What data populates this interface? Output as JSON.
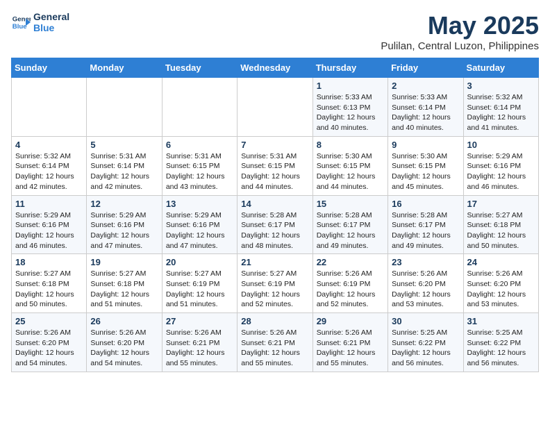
{
  "logo": {
    "line1": "General",
    "line2": "Blue"
  },
  "title": "May 2025",
  "location": "Pulilan, Central Luzon, Philippines",
  "days_of_week": [
    "Sunday",
    "Monday",
    "Tuesday",
    "Wednesday",
    "Thursday",
    "Friday",
    "Saturday"
  ],
  "weeks": [
    [
      {
        "day": "",
        "info": ""
      },
      {
        "day": "",
        "info": ""
      },
      {
        "day": "",
        "info": ""
      },
      {
        "day": "",
        "info": ""
      },
      {
        "day": "1",
        "info": "Sunrise: 5:33 AM\nSunset: 6:13 PM\nDaylight: 12 hours\nand 40 minutes."
      },
      {
        "day": "2",
        "info": "Sunrise: 5:33 AM\nSunset: 6:14 PM\nDaylight: 12 hours\nand 40 minutes."
      },
      {
        "day": "3",
        "info": "Sunrise: 5:32 AM\nSunset: 6:14 PM\nDaylight: 12 hours\nand 41 minutes."
      }
    ],
    [
      {
        "day": "4",
        "info": "Sunrise: 5:32 AM\nSunset: 6:14 PM\nDaylight: 12 hours\nand 42 minutes."
      },
      {
        "day": "5",
        "info": "Sunrise: 5:31 AM\nSunset: 6:14 PM\nDaylight: 12 hours\nand 42 minutes."
      },
      {
        "day": "6",
        "info": "Sunrise: 5:31 AM\nSunset: 6:15 PM\nDaylight: 12 hours\nand 43 minutes."
      },
      {
        "day": "7",
        "info": "Sunrise: 5:31 AM\nSunset: 6:15 PM\nDaylight: 12 hours\nand 44 minutes."
      },
      {
        "day": "8",
        "info": "Sunrise: 5:30 AM\nSunset: 6:15 PM\nDaylight: 12 hours\nand 44 minutes."
      },
      {
        "day": "9",
        "info": "Sunrise: 5:30 AM\nSunset: 6:15 PM\nDaylight: 12 hours\nand 45 minutes."
      },
      {
        "day": "10",
        "info": "Sunrise: 5:29 AM\nSunset: 6:16 PM\nDaylight: 12 hours\nand 46 minutes."
      }
    ],
    [
      {
        "day": "11",
        "info": "Sunrise: 5:29 AM\nSunset: 6:16 PM\nDaylight: 12 hours\nand 46 minutes."
      },
      {
        "day": "12",
        "info": "Sunrise: 5:29 AM\nSunset: 6:16 PM\nDaylight: 12 hours\nand 47 minutes."
      },
      {
        "day": "13",
        "info": "Sunrise: 5:29 AM\nSunset: 6:16 PM\nDaylight: 12 hours\nand 47 minutes."
      },
      {
        "day": "14",
        "info": "Sunrise: 5:28 AM\nSunset: 6:17 PM\nDaylight: 12 hours\nand 48 minutes."
      },
      {
        "day": "15",
        "info": "Sunrise: 5:28 AM\nSunset: 6:17 PM\nDaylight: 12 hours\nand 49 minutes."
      },
      {
        "day": "16",
        "info": "Sunrise: 5:28 AM\nSunset: 6:17 PM\nDaylight: 12 hours\nand 49 minutes."
      },
      {
        "day": "17",
        "info": "Sunrise: 5:27 AM\nSunset: 6:18 PM\nDaylight: 12 hours\nand 50 minutes."
      }
    ],
    [
      {
        "day": "18",
        "info": "Sunrise: 5:27 AM\nSunset: 6:18 PM\nDaylight: 12 hours\nand 50 minutes."
      },
      {
        "day": "19",
        "info": "Sunrise: 5:27 AM\nSunset: 6:18 PM\nDaylight: 12 hours\nand 51 minutes."
      },
      {
        "day": "20",
        "info": "Sunrise: 5:27 AM\nSunset: 6:19 PM\nDaylight: 12 hours\nand 51 minutes."
      },
      {
        "day": "21",
        "info": "Sunrise: 5:27 AM\nSunset: 6:19 PM\nDaylight: 12 hours\nand 52 minutes."
      },
      {
        "day": "22",
        "info": "Sunrise: 5:26 AM\nSunset: 6:19 PM\nDaylight: 12 hours\nand 52 minutes."
      },
      {
        "day": "23",
        "info": "Sunrise: 5:26 AM\nSunset: 6:20 PM\nDaylight: 12 hours\nand 53 minutes."
      },
      {
        "day": "24",
        "info": "Sunrise: 5:26 AM\nSunset: 6:20 PM\nDaylight: 12 hours\nand 53 minutes."
      }
    ],
    [
      {
        "day": "25",
        "info": "Sunrise: 5:26 AM\nSunset: 6:20 PM\nDaylight: 12 hours\nand 54 minutes."
      },
      {
        "day": "26",
        "info": "Sunrise: 5:26 AM\nSunset: 6:20 PM\nDaylight: 12 hours\nand 54 minutes."
      },
      {
        "day": "27",
        "info": "Sunrise: 5:26 AM\nSunset: 6:21 PM\nDaylight: 12 hours\nand 55 minutes."
      },
      {
        "day": "28",
        "info": "Sunrise: 5:26 AM\nSunset: 6:21 PM\nDaylight: 12 hours\nand 55 minutes."
      },
      {
        "day": "29",
        "info": "Sunrise: 5:26 AM\nSunset: 6:21 PM\nDaylight: 12 hours\nand 55 minutes."
      },
      {
        "day": "30",
        "info": "Sunrise: 5:25 AM\nSunset: 6:22 PM\nDaylight: 12 hours\nand 56 minutes."
      },
      {
        "day": "31",
        "info": "Sunrise: 5:25 AM\nSunset: 6:22 PM\nDaylight: 12 hours\nand 56 minutes."
      }
    ]
  ]
}
